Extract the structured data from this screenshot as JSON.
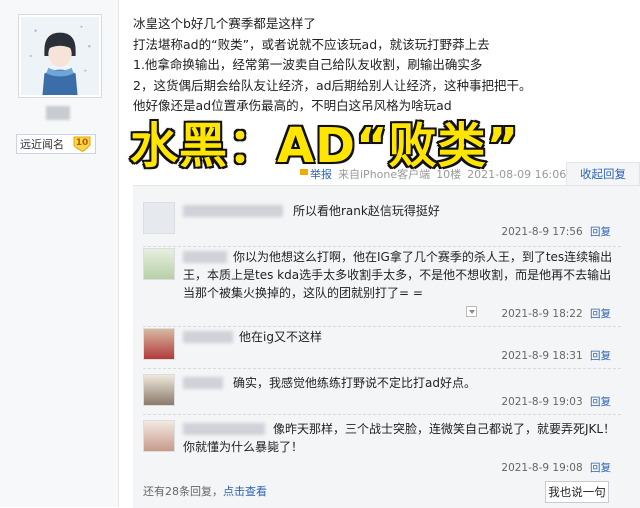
{
  "user": {
    "level_label": "远近闻名",
    "level_number": "10"
  },
  "post": {
    "lines": [
      "冰皇这个b好几个赛季都是这样了",
      "打法堪称ad的“败类”，或者说就不应该玩ad，就该玩打野莽上去",
      "1.他拿命换输出，经常第一波卖自己给队友收割，刷输出确实多",
      "2，这货偶后期会给队友让经济，ad后期给别人让经济，这种事把把干。",
      "他好像还是ad位置承伤最高的，不明白这吊风格为啥玩ad"
    ],
    "headline": "水黑：AD“败类”",
    "meta": {
      "report": "举报",
      "source": "来自iPhone客户端",
      "floor": "10楼",
      "time": "2021-08-09 16:06"
    },
    "toggle_replies": "收起回复"
  },
  "replies": [
    {
      "text": "所以看他rank赵信玩得挺好",
      "time": "2021-8-9 17:56",
      "action": "回复"
    },
    {
      "text": "你以为他想这么打啊，他在IG拿了几个赛季的杀人王，到了tes连续输出王，本质上是tes kda选手太多收割手太多，不是他不想收割，而是他再不去输出当那个被集火换掉的，这队的团就别打了= =",
      "time": "2021-8-9 18:22",
      "action": "回复"
    },
    {
      "text": "他在ig又不这样",
      "time": "2021-8-9 18:31",
      "action": "回复"
    },
    {
      "text": "确实，我感觉他练练打野说不定比打ad好点。",
      "time": "2021-8-9 19:03",
      "action": "回复"
    },
    {
      "text": "像昨天那样，三个战士突脸，连微笑自己都说了，就要弄死JKL！你就懂为什么暴毙了！",
      "time": "2021-8-9 19:08",
      "action": "回复"
    }
  ],
  "footer": {
    "more_prefix": "还有28条回复，",
    "more_link": "点击查看",
    "reply_button": "我也说一句"
  },
  "colors": {
    "headline_fill": "#ffe500",
    "headline_stroke": "#111111",
    "link": "#2d64b3"
  }
}
